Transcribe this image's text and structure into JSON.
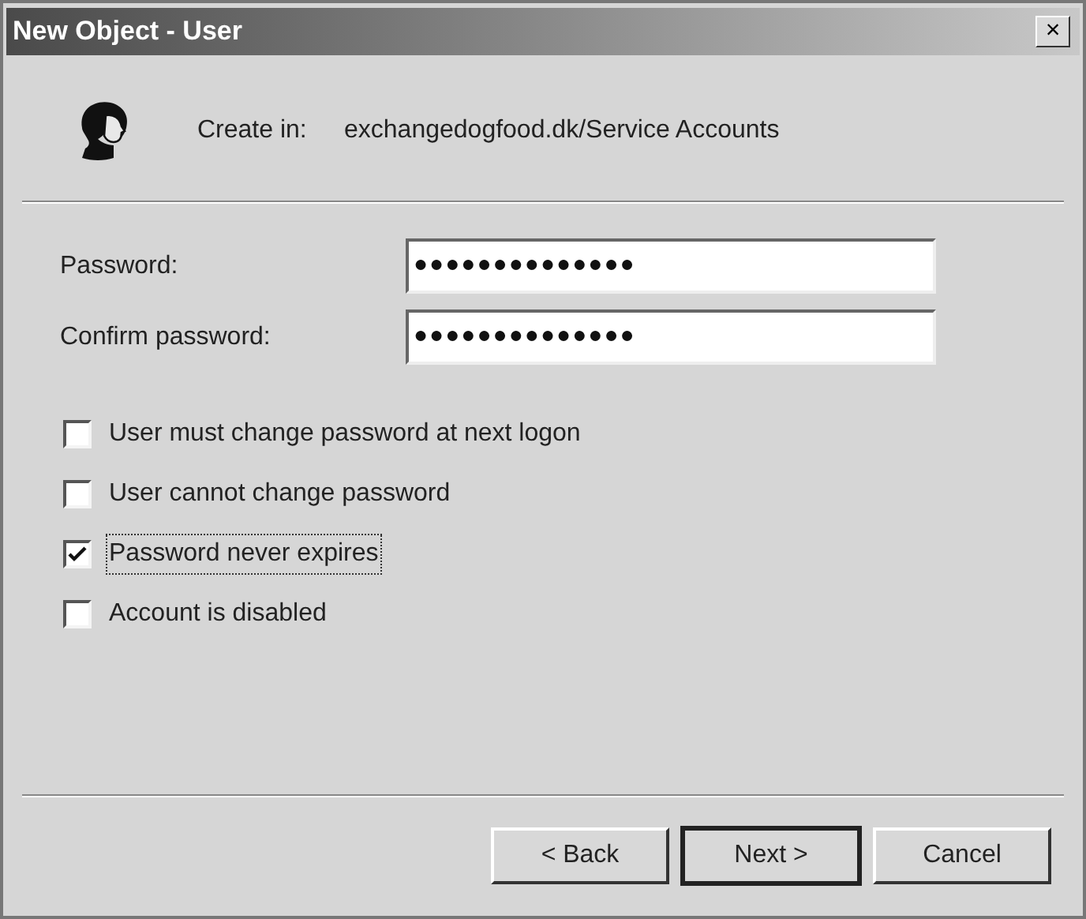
{
  "window": {
    "title": "New Object - User",
    "close_button": "×"
  },
  "header": {
    "label": "Create in:",
    "path": "exchangedogfood.dk/Service Accounts"
  },
  "fields": [
    {
      "label": "Password:",
      "value": "●●●●●●●●●●●●●●"
    },
    {
      "label": "Confirm password:",
      "value": "●●●●●●●●●●●●●●"
    }
  ],
  "options": [
    {
      "label": "User must change password at next logon",
      "checked": false,
      "focused": false
    },
    {
      "label": "User cannot change password",
      "checked": false,
      "focused": false
    },
    {
      "label": "Password never expires",
      "checked": true,
      "focused": true
    },
    {
      "label": "Account is disabled",
      "checked": false,
      "focused": false
    }
  ],
  "buttons": [
    {
      "label": "< Back",
      "default": false
    },
    {
      "label": "Next >",
      "default": true
    },
    {
      "label": "Cancel",
      "default": false
    }
  ]
}
